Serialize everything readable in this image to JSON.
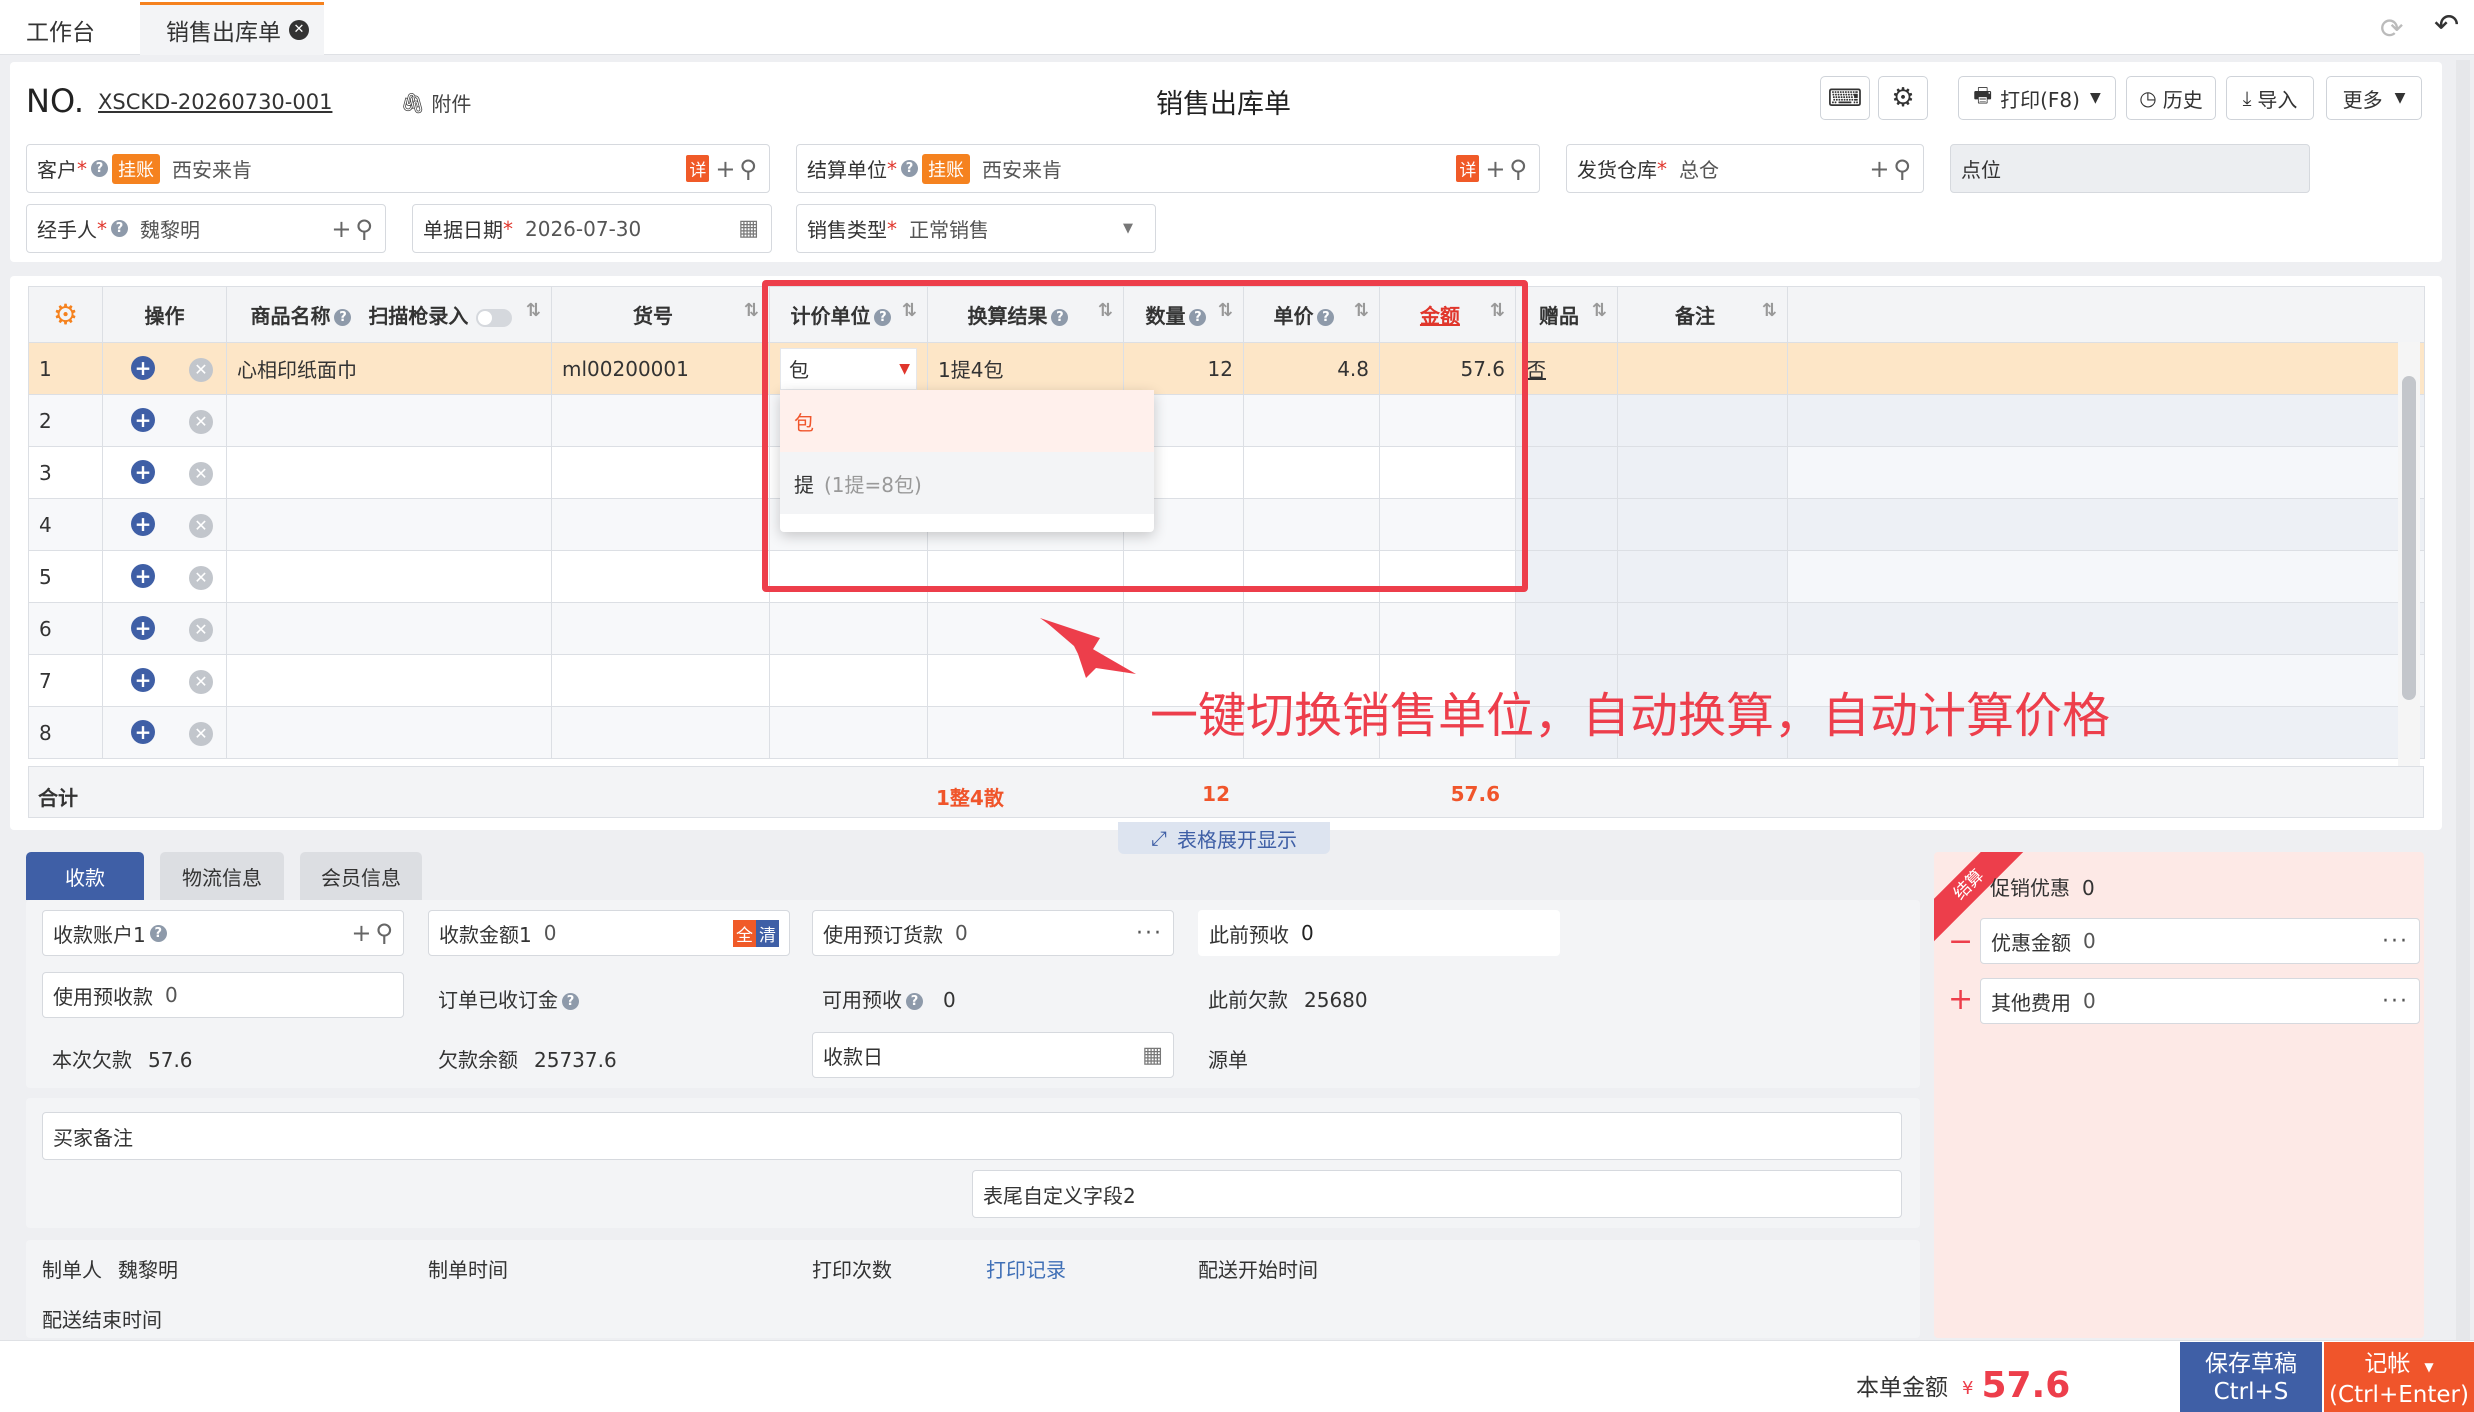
{
  "tabs": {
    "home": "工作台",
    "current": "销售出库单"
  },
  "header": {
    "no_label": "NO.",
    "no_value": "XSCKD-20260730-001",
    "attach": "附件",
    "title": "销售出库单",
    "print": "打印(F8)",
    "history": "历史",
    "import": "导入",
    "more": "更多"
  },
  "form": {
    "customer_label": "客户",
    "customer_tag": "挂账",
    "customer_value": "西安来肯",
    "detail_tag": "详",
    "settle_label": "结算单位",
    "settle_tag": "挂账",
    "settle_value": "西安来肯",
    "warehouse_label": "发货仓库",
    "warehouse_value": "总仓",
    "location_label": "点位",
    "handler_label": "经手人",
    "handler_value": "魏黎明",
    "date_label": "单据日期",
    "date_value": "2026-07-30",
    "saletype_label": "销售类型",
    "saletype_value": "正常销售",
    "required_mark": "*"
  },
  "table": {
    "headers": {
      "op": "操作",
      "name": "商品名称",
      "scan": "扫描枪录入",
      "code": "货号",
      "unit": "计价单位",
      "conv": "换算结果",
      "qty": "数量",
      "price": "单价",
      "amount": "金额",
      "gift": "赠品",
      "remark": "备注"
    },
    "rows": [
      {
        "n": "1",
        "name": "心相印纸面巾",
        "code": "ml00200001",
        "unit": "包",
        "conv": "1提4包",
        "qty": "12",
        "price": "4.8",
        "amount": "57.6",
        "gift": "否"
      },
      {
        "n": "2"
      },
      {
        "n": "3"
      },
      {
        "n": "4"
      },
      {
        "n": "5"
      },
      {
        "n": "6"
      },
      {
        "n": "7"
      },
      {
        "n": "8"
      }
    ],
    "total": {
      "label": "合计",
      "conv": "1整4散",
      "qty": "12",
      "amount": "57.6"
    },
    "expand": "表格展开显示",
    "dropdown": {
      "opt1": "包",
      "opt2": "提",
      "opt2_note": "(1提=8包)"
    }
  },
  "annotation": "一键切换销售单位，自动换算，自动计算价格",
  "bottom_tabs": {
    "t1": "收款",
    "t2": "物流信息",
    "t3": "会员信息"
  },
  "payment": {
    "account_label": "收款账户1",
    "amount_label": "收款金额1",
    "amount_value": "0",
    "tag_all": "全",
    "tag_clear": "清",
    "use_prepay_goods_label": "使用预订货款",
    "use_prepay_goods_value": "0",
    "prev_prepay_label": "此前预收",
    "prev_prepay_value": "0",
    "use_prepay_label": "使用预收款",
    "use_prepay_value": "0",
    "order_deposit_label": "订单已收订金",
    "avail_prepay_label": "可用预收",
    "avail_prepay_value": "0",
    "prev_debt_label": "此前欠款",
    "prev_debt_value": "25680",
    "this_debt_label": "本次欠款",
    "this_debt_value": "57.6",
    "debt_balance_label": "欠款余额",
    "debt_balance_value": "25737.6",
    "pay_date_label": "收款日",
    "source_label": "源单",
    "buyer_remark": "买家备注",
    "custom_field2": "表尾自定义字段2"
  },
  "meta": {
    "creator_label": "制单人",
    "creator_value": "魏黎明",
    "create_time_label": "制单时间",
    "print_count_label": "打印次数",
    "print_record": "打印记录",
    "delivery_start_label": "配送开始时间",
    "delivery_end_label": "配送结束时间"
  },
  "settle": {
    "ribbon": "结算",
    "promo_label": "促销优惠",
    "promo_value": "0",
    "discount_label": "优惠金额",
    "discount_value": "0",
    "other_label": "其他费用",
    "other_value": "0"
  },
  "footer": {
    "total_label": "本单金额",
    "currency": "¥",
    "total_value": "57.6",
    "draft": "保存草稿",
    "draft_key": "Ctrl+S",
    "post": "记帐",
    "post_key": "(Ctrl+Enter)"
  }
}
